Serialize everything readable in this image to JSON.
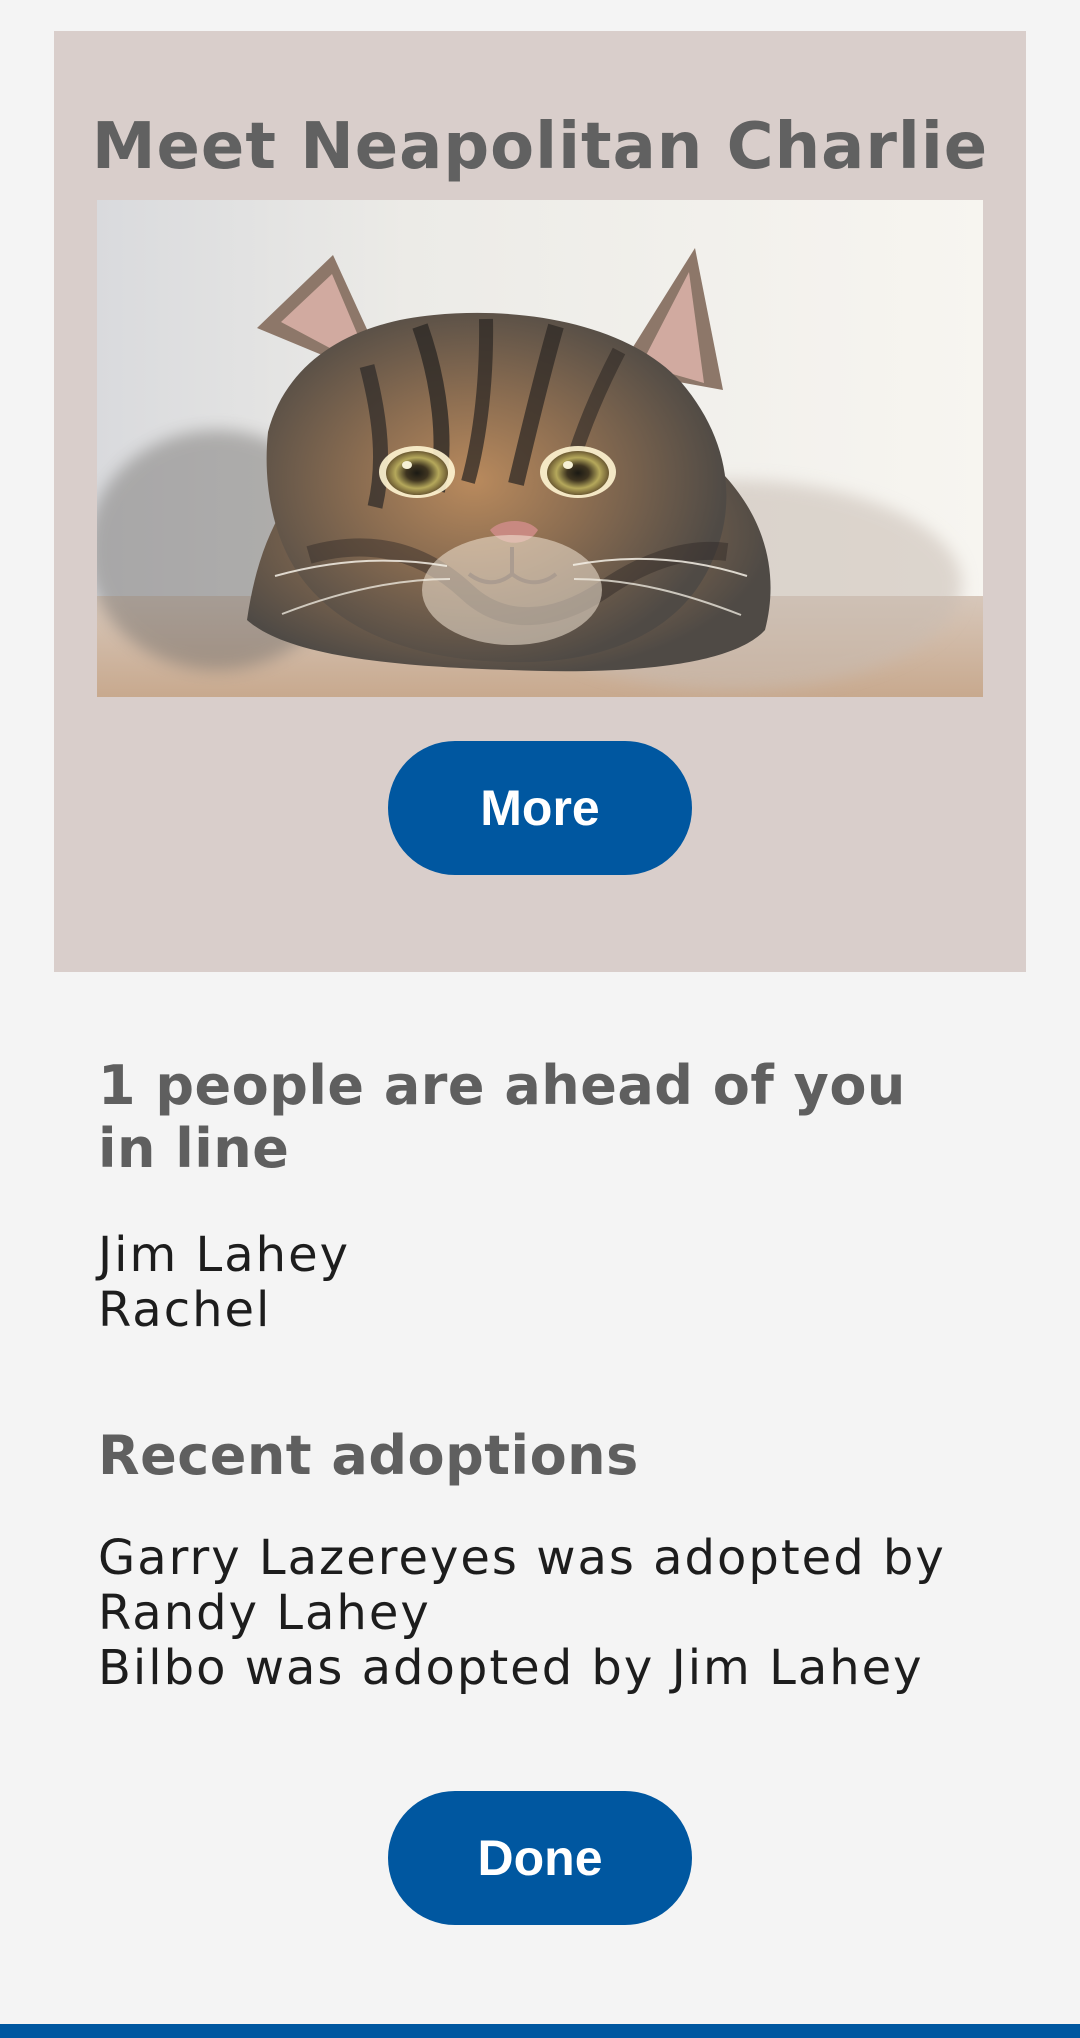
{
  "pet": {
    "title": "Meet Neapolitan Charlie",
    "image_subject": "tabby cat",
    "more_label": "More"
  },
  "queue": {
    "heading": "1 people are ahead of you in line",
    "people": [
      "Jim Lahey",
      "Rachel"
    ]
  },
  "recent_adoptions": {
    "heading": "Recent adoptions",
    "items": [
      "Garry Lazereyes was adopted by Randy Lahey",
      "Bilbo was adopted by Jim Lahey"
    ]
  },
  "actions": {
    "done_label": "Done"
  },
  "colors": {
    "card_background": "#d9cecb",
    "button": "#0057a0",
    "page_background": "#f4f4f4"
  }
}
